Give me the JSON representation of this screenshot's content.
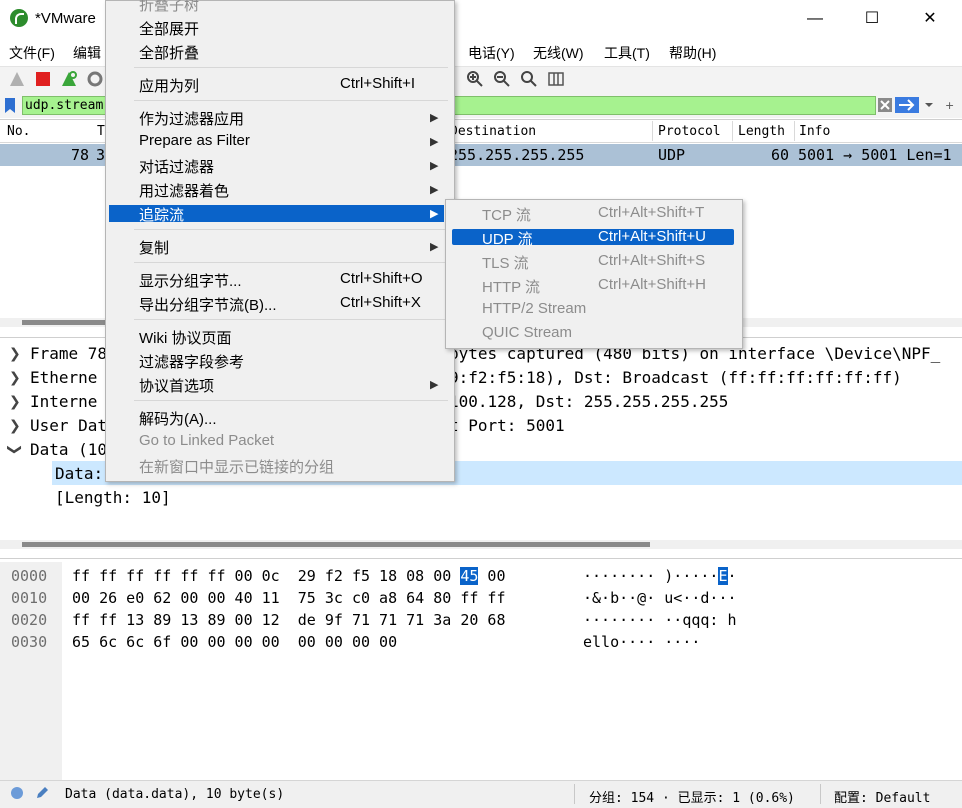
{
  "window": {
    "title": "*VMware",
    "minimize": "—",
    "maximize": "☐",
    "close": "✕"
  },
  "menubar": {
    "left_items": [
      "文件(F)",
      "编辑"
    ],
    "right_items": [
      "电话(Y)",
      "无线(W)",
      "工具(T)",
      "帮助(H)"
    ]
  },
  "filter": {
    "value": "udp.stream"
  },
  "packet_list": {
    "columns": [
      "No.",
      "T",
      "Destination",
      "Protocol",
      "Length",
      "Info"
    ],
    "row": {
      "no": "78",
      "time_partial": "3",
      "destination": "255.255.255.255",
      "protocol": "UDP",
      "length": "60",
      "info": "5001 → 5001 Len=1"
    }
  },
  "details": {
    "rows": [
      {
        "label": "Frame 78",
        "rest": "bytes captured (480 bits) on interface \\Device\\NPF_"
      },
      {
        "label": "Etherne",
        "rest": "9:f2:f5:18), Dst: Broadcast (ff:ff:ff:ff:ff:ff)"
      },
      {
        "label": "Interne",
        "rest": "100.128, Dst: 255.255.255.255"
      },
      {
        "label": "User Dat",
        "rest": "t Port: 5001"
      },
      {
        "label": "Data (10",
        "rest": ""
      }
    ],
    "data_child": "Data:",
    "length_child": "[Length: 10]"
  },
  "bytes": {
    "offsets": [
      "0000",
      "0010",
      "0020",
      "0030"
    ],
    "hex": [
      {
        "a": "ff ff ff ff ff ff 00 0c  29 f2 f5 18 08 00 ",
        "hl": "45",
        "b": " 00"
      },
      {
        "a": "00 26 e0 62 00 00 40 11  75 3c c0 a8 64 80 ff ff",
        "hl": "",
        "b": ""
      },
      {
        "a": "ff ff 13 89 13 89 00 12  de 9f 71 71 71 3a 20 68",
        "hl": "",
        "b": ""
      },
      {
        "a": "65 6c 6c 6f 00 00 00 00  00 00 00 00",
        "hl": "",
        "b": ""
      }
    ],
    "ascii": [
      {
        "a": "········ )·····",
        "hl": "E",
        "b": "·"
      },
      {
        "a": "·&·b··@· u<··d···",
        "hl": "",
        "b": ""
      },
      {
        "a": "········ ··qqq: h",
        "hl": "",
        "b": ""
      },
      {
        "a": "ello···· ····",
        "hl": "",
        "b": ""
      }
    ]
  },
  "status": {
    "field": "Data (data.data), 10 byte(s)",
    "packets": "分组: 154 · 已显示: 1 (0.6%)",
    "profile": "配置: Default"
  },
  "context_menu": {
    "items": [
      {
        "label": "折叠子树",
        "shortcut": "",
        "arrow": false,
        "disabled": true
      },
      {
        "label": "全部展开",
        "shortcut": "",
        "arrow": false,
        "disabled": false
      },
      {
        "label": "全部折叠",
        "shortcut": "",
        "arrow": false,
        "disabled": false
      },
      {
        "label": "应用为列",
        "shortcut": "Ctrl+Shift+I",
        "arrow": false,
        "disabled": false
      },
      {
        "label": "作为过滤器应用",
        "shortcut": "",
        "arrow": true,
        "disabled": false
      },
      {
        "label": "Prepare as Filter",
        "shortcut": "",
        "arrow": true,
        "disabled": false
      },
      {
        "label": "对话过滤器",
        "shortcut": "",
        "arrow": true,
        "disabled": false
      },
      {
        "label": "用过滤器着色",
        "shortcut": "",
        "arrow": true,
        "disabled": false
      },
      {
        "label": "追踪流",
        "shortcut": "",
        "arrow": true,
        "disabled": false
      },
      {
        "label": "复制",
        "shortcut": "",
        "arrow": true,
        "disabled": false
      },
      {
        "label": "显示分组字节...",
        "shortcut": "Ctrl+Shift+O",
        "arrow": false,
        "disabled": false
      },
      {
        "label": "导出分组字节流(B)...",
        "shortcut": "Ctrl+Shift+X",
        "arrow": false,
        "disabled": false
      },
      {
        "label": "Wiki 协议页面",
        "shortcut": "",
        "arrow": false,
        "disabled": false
      },
      {
        "label": "过滤器字段参考",
        "shortcut": "",
        "arrow": false,
        "disabled": false
      },
      {
        "label": "协议首选项",
        "shortcut": "",
        "arrow": true,
        "disabled": false
      },
      {
        "label": "解码为(A)...",
        "shortcut": "",
        "arrow": false,
        "disabled": false
      },
      {
        "label": "Go to Linked Packet",
        "shortcut": "",
        "arrow": false,
        "disabled": true
      },
      {
        "label": "在新窗口中显示已链接的分组",
        "shortcut": "",
        "arrow": false,
        "disabled": true
      }
    ],
    "arrow_glyph": "▶"
  },
  "submenu": {
    "items": [
      {
        "label": "TCP 流",
        "shortcut": "Ctrl+Alt+Shift+T",
        "disabled": true
      },
      {
        "label": "UDP 流",
        "shortcut": "Ctrl+Alt+Shift+U",
        "disabled": false
      },
      {
        "label": "TLS 流",
        "shortcut": "Ctrl+Alt+Shift+S",
        "disabled": true
      },
      {
        "label": "HTTP 流",
        "shortcut": "Ctrl+Alt+Shift+H",
        "disabled": true
      },
      {
        "label": "HTTP/2 Stream",
        "shortcut": "",
        "disabled": true
      },
      {
        "label": "QUIC Stream",
        "shortcut": "",
        "disabled": true
      }
    ]
  },
  "colors": {
    "filter_ok": "#a6f28f",
    "selection": "#0a63c9",
    "row_selected": "#abc1d6"
  }
}
